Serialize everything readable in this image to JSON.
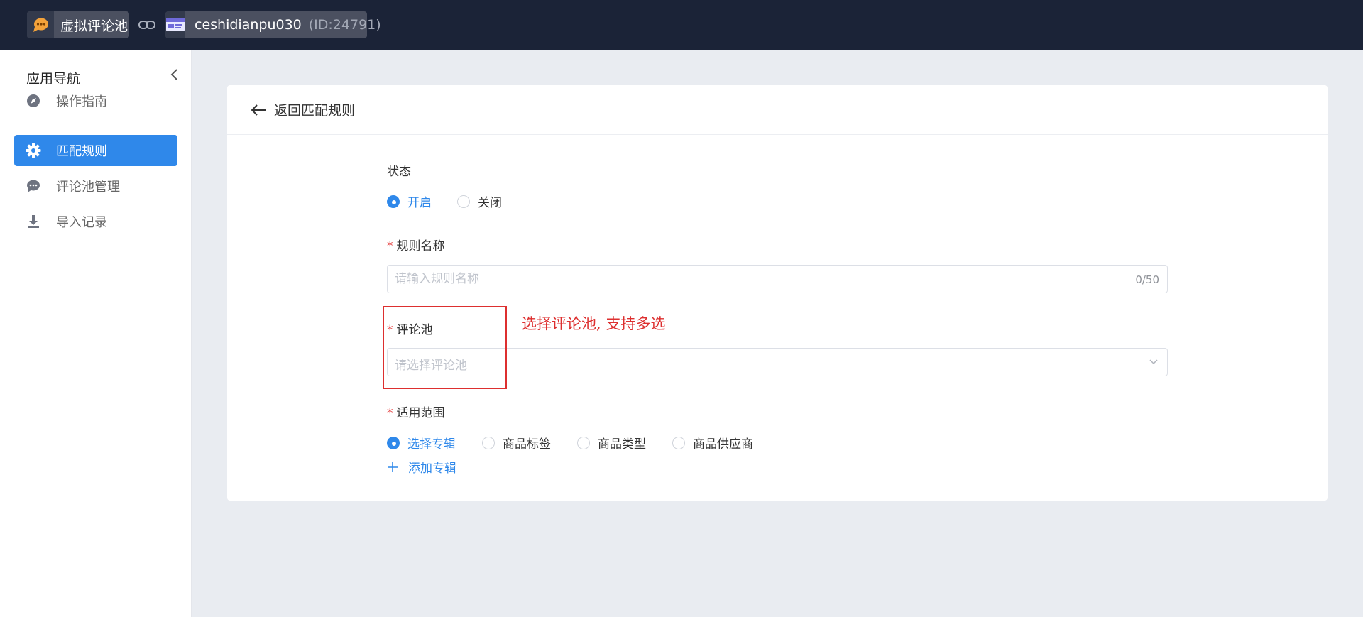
{
  "topbar": {
    "app_name": "虚拟评论池",
    "store_name": "ceshidianpu030",
    "store_id": "(ID:24791)"
  },
  "sidebar": {
    "title": "应用导航",
    "items": [
      {
        "label": "操作指南",
        "icon": "compass-icon",
        "active": false
      },
      {
        "label": "匹配规则",
        "icon": "gear-icon",
        "active": true
      },
      {
        "label": "评论池管理",
        "icon": "chat-icon",
        "active": false
      },
      {
        "label": "导入记录",
        "icon": "download-icon",
        "active": false
      }
    ]
  },
  "header": {
    "back_label": "返回匹配规则"
  },
  "form": {
    "status": {
      "label": "状态",
      "options": [
        "开启",
        "关闭"
      ],
      "selected": "开启"
    },
    "rule_name": {
      "required_mark": "*",
      "label": "规则名称",
      "placeholder": "请输入规则名称",
      "counter": "0/50"
    },
    "pool": {
      "required_mark": "*",
      "label": "评论池",
      "placeholder": "请选择评论池"
    },
    "scope": {
      "required_mark": "*",
      "label": "适用范围",
      "options": [
        "选择专辑",
        "商品标签",
        "商品类型",
        "商品供应商"
      ],
      "selected": "选择专辑",
      "add_label": "添加专辑"
    }
  },
  "annotation": {
    "text": "选择评论池, 支持多选"
  },
  "colors": {
    "topbar_bg": "#1b2337",
    "accent": "#2f88ea",
    "annotation": "#dd2f2f",
    "page_bg": "#e9ecf1"
  }
}
